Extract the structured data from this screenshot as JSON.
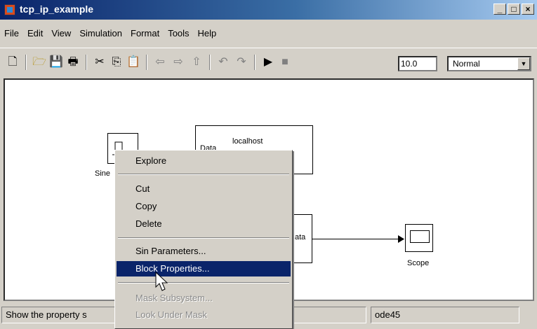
{
  "window": {
    "title": "tcp_ip_example"
  },
  "menubar": {
    "items": [
      "File",
      "Edit",
      "View",
      "Simulation",
      "Format",
      "Tools",
      "Help"
    ]
  },
  "toolbar": {
    "stop_time": "10.0",
    "sim_mode": "Normal"
  },
  "blocks": {
    "sine": {
      "label": "Sine"
    },
    "send": {
      "port_label": "Data",
      "host_label": "localhost"
    },
    "receive": {
      "port_label": "ata"
    },
    "scope": {
      "label": "Scope"
    }
  },
  "context_menu": {
    "items": [
      {
        "label": "Explore"
      },
      {
        "label": "Cut"
      },
      {
        "label": "Copy"
      },
      {
        "label": "Delete"
      },
      {
        "label": "Sin Parameters..."
      },
      {
        "label": "Block Properties..."
      },
      {
        "label": "Mask Subsystem..."
      },
      {
        "label": "Look Under Mask"
      }
    ]
  },
  "statusbar": {
    "message": "Show the property s",
    "solver": "ode45"
  }
}
